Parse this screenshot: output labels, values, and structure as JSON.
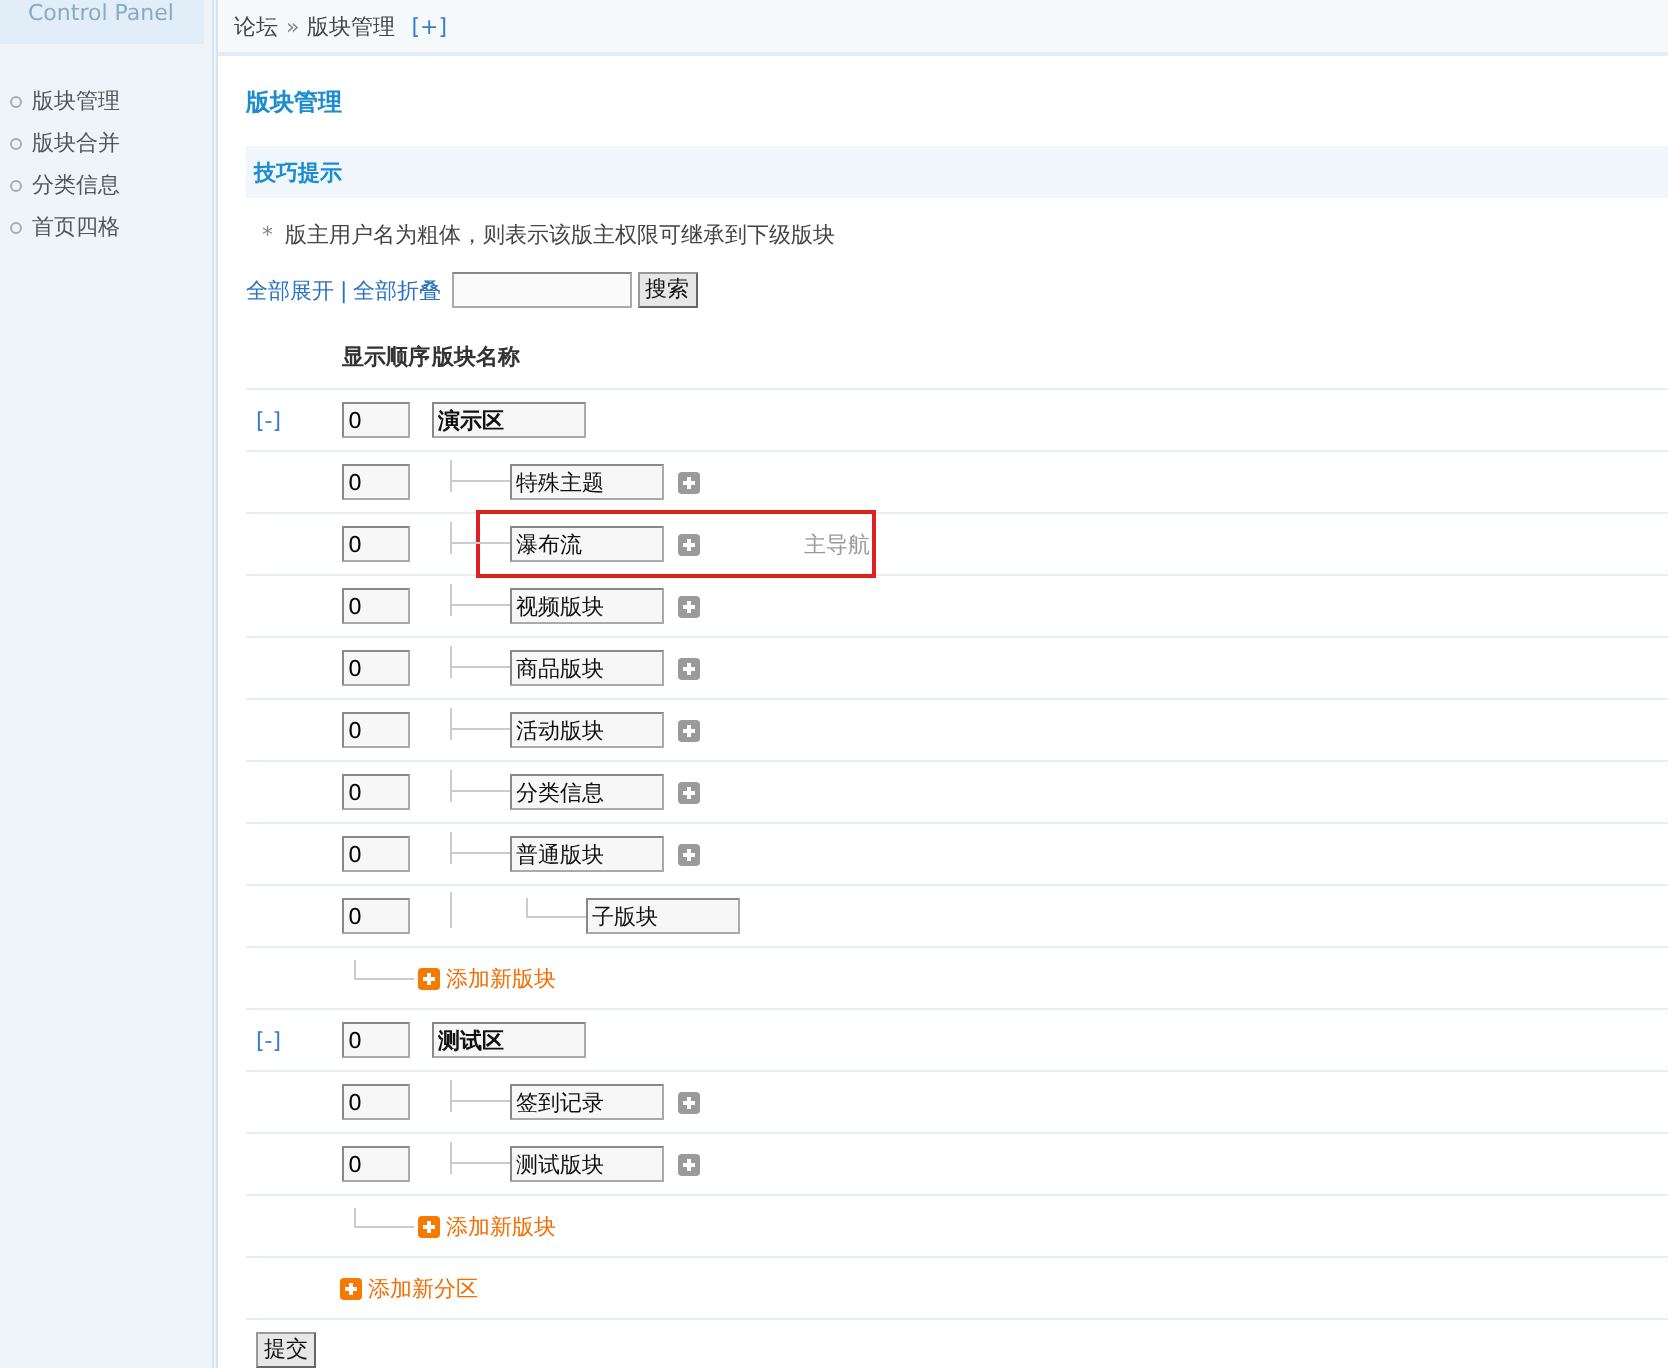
{
  "sidebar": {
    "title": "Control Panel",
    "items": [
      {
        "label": "版块管理"
      },
      {
        "label": "版块合并"
      },
      {
        "label": "分类信息"
      },
      {
        "label": "首页四格"
      }
    ]
  },
  "breadcrumb": {
    "items": [
      "论坛",
      "版块管理"
    ],
    "separator": "»",
    "toggle": "[+]"
  },
  "page_title": "版块管理",
  "tips": {
    "title": "技巧提示",
    "bullet": "*",
    "items": [
      "版主用户名为粗体，则表示该版主权限可继承到下级版块"
    ]
  },
  "toolbar": {
    "expand_all": "全部展开",
    "separator": "|",
    "collapse_all": "全部折叠",
    "search_button": "搜索"
  },
  "table": {
    "columns": [
      "显示顺序",
      "版块名称"
    ],
    "groups": [
      {
        "toggle": "[-]",
        "order": "0",
        "name": "演示区",
        "add_label": "添加新版块",
        "children": [
          {
            "order": "0",
            "name": "特殊主题",
            "highlighted": false
          },
          {
            "order": "0",
            "name": "瀑布流",
            "note": "主导航",
            "highlighted": true
          },
          {
            "order": "0",
            "name": "视频版块",
            "highlighted": false
          },
          {
            "order": "0",
            "name": "商品版块",
            "highlighted": false
          },
          {
            "order": "0",
            "name": "活动版块",
            "highlighted": false
          },
          {
            "order": "0",
            "name": "分类信息",
            "highlighted": false
          },
          {
            "order": "0",
            "name": "普通版块",
            "highlighted": false,
            "children": [
              {
                "order": "0",
                "name": "子版块"
              }
            ]
          }
        ]
      },
      {
        "toggle": "[-]",
        "order": "0",
        "name": "测试区",
        "add_label": "添加新版块",
        "children": [
          {
            "order": "0",
            "name": "签到记录",
            "highlighted": false
          },
          {
            "order": "0",
            "name": "测试版块",
            "highlighted": false
          }
        ]
      }
    ],
    "add_category": "添加新分区"
  },
  "submit": "提交"
}
